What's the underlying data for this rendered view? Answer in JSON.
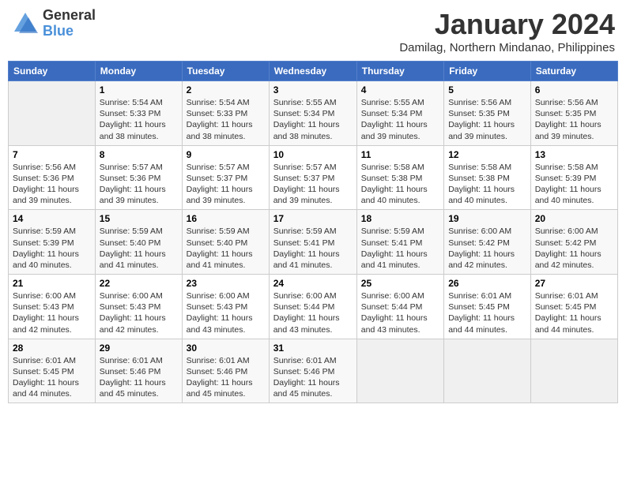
{
  "logo": {
    "general": "General",
    "blue": "Blue"
  },
  "title": "January 2024",
  "location": "Damilag, Northern Mindanao, Philippines",
  "days_of_week": [
    "Sunday",
    "Monday",
    "Tuesday",
    "Wednesday",
    "Thursday",
    "Friday",
    "Saturday"
  ],
  "weeks": [
    [
      {
        "day": "",
        "info": ""
      },
      {
        "day": "1",
        "info": "Sunrise: 5:54 AM\nSunset: 5:33 PM\nDaylight: 11 hours\nand 38 minutes."
      },
      {
        "day": "2",
        "info": "Sunrise: 5:54 AM\nSunset: 5:33 PM\nDaylight: 11 hours\nand 38 minutes."
      },
      {
        "day": "3",
        "info": "Sunrise: 5:55 AM\nSunset: 5:34 PM\nDaylight: 11 hours\nand 38 minutes."
      },
      {
        "day": "4",
        "info": "Sunrise: 5:55 AM\nSunset: 5:34 PM\nDaylight: 11 hours\nand 39 minutes."
      },
      {
        "day": "5",
        "info": "Sunrise: 5:56 AM\nSunset: 5:35 PM\nDaylight: 11 hours\nand 39 minutes."
      },
      {
        "day": "6",
        "info": "Sunrise: 5:56 AM\nSunset: 5:35 PM\nDaylight: 11 hours\nand 39 minutes."
      }
    ],
    [
      {
        "day": "7",
        "info": "Sunrise: 5:56 AM\nSunset: 5:36 PM\nDaylight: 11 hours\nand 39 minutes."
      },
      {
        "day": "8",
        "info": "Sunrise: 5:57 AM\nSunset: 5:36 PM\nDaylight: 11 hours\nand 39 minutes."
      },
      {
        "day": "9",
        "info": "Sunrise: 5:57 AM\nSunset: 5:37 PM\nDaylight: 11 hours\nand 39 minutes."
      },
      {
        "day": "10",
        "info": "Sunrise: 5:57 AM\nSunset: 5:37 PM\nDaylight: 11 hours\nand 39 minutes."
      },
      {
        "day": "11",
        "info": "Sunrise: 5:58 AM\nSunset: 5:38 PM\nDaylight: 11 hours\nand 40 minutes."
      },
      {
        "day": "12",
        "info": "Sunrise: 5:58 AM\nSunset: 5:38 PM\nDaylight: 11 hours\nand 40 minutes."
      },
      {
        "day": "13",
        "info": "Sunrise: 5:58 AM\nSunset: 5:39 PM\nDaylight: 11 hours\nand 40 minutes."
      }
    ],
    [
      {
        "day": "14",
        "info": "Sunrise: 5:59 AM\nSunset: 5:39 PM\nDaylight: 11 hours\nand 40 minutes."
      },
      {
        "day": "15",
        "info": "Sunrise: 5:59 AM\nSunset: 5:40 PM\nDaylight: 11 hours\nand 41 minutes."
      },
      {
        "day": "16",
        "info": "Sunrise: 5:59 AM\nSunset: 5:40 PM\nDaylight: 11 hours\nand 41 minutes."
      },
      {
        "day": "17",
        "info": "Sunrise: 5:59 AM\nSunset: 5:41 PM\nDaylight: 11 hours\nand 41 minutes."
      },
      {
        "day": "18",
        "info": "Sunrise: 5:59 AM\nSunset: 5:41 PM\nDaylight: 11 hours\nand 41 minutes."
      },
      {
        "day": "19",
        "info": "Sunrise: 6:00 AM\nSunset: 5:42 PM\nDaylight: 11 hours\nand 42 minutes."
      },
      {
        "day": "20",
        "info": "Sunrise: 6:00 AM\nSunset: 5:42 PM\nDaylight: 11 hours\nand 42 minutes."
      }
    ],
    [
      {
        "day": "21",
        "info": "Sunrise: 6:00 AM\nSunset: 5:43 PM\nDaylight: 11 hours\nand 42 minutes."
      },
      {
        "day": "22",
        "info": "Sunrise: 6:00 AM\nSunset: 5:43 PM\nDaylight: 11 hours\nand 42 minutes."
      },
      {
        "day": "23",
        "info": "Sunrise: 6:00 AM\nSunset: 5:43 PM\nDaylight: 11 hours\nand 43 minutes."
      },
      {
        "day": "24",
        "info": "Sunrise: 6:00 AM\nSunset: 5:44 PM\nDaylight: 11 hours\nand 43 minutes."
      },
      {
        "day": "25",
        "info": "Sunrise: 6:00 AM\nSunset: 5:44 PM\nDaylight: 11 hours\nand 43 minutes."
      },
      {
        "day": "26",
        "info": "Sunrise: 6:01 AM\nSunset: 5:45 PM\nDaylight: 11 hours\nand 44 minutes."
      },
      {
        "day": "27",
        "info": "Sunrise: 6:01 AM\nSunset: 5:45 PM\nDaylight: 11 hours\nand 44 minutes."
      }
    ],
    [
      {
        "day": "28",
        "info": "Sunrise: 6:01 AM\nSunset: 5:45 PM\nDaylight: 11 hours\nand 44 minutes."
      },
      {
        "day": "29",
        "info": "Sunrise: 6:01 AM\nSunset: 5:46 PM\nDaylight: 11 hours\nand 45 minutes."
      },
      {
        "day": "30",
        "info": "Sunrise: 6:01 AM\nSunset: 5:46 PM\nDaylight: 11 hours\nand 45 minutes."
      },
      {
        "day": "31",
        "info": "Sunrise: 6:01 AM\nSunset: 5:46 PM\nDaylight: 11 hours\nand 45 minutes."
      },
      {
        "day": "",
        "info": ""
      },
      {
        "day": "",
        "info": ""
      },
      {
        "day": "",
        "info": ""
      }
    ]
  ]
}
